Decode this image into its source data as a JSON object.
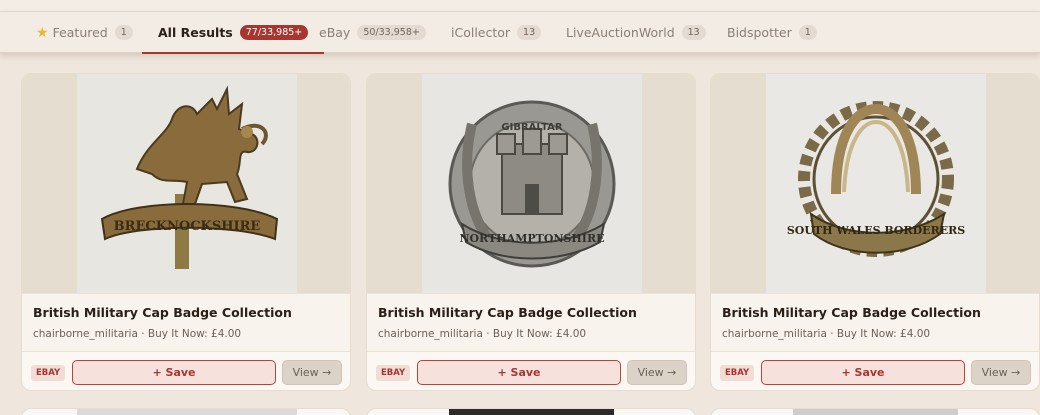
{
  "tabs": [
    {
      "label": "Featured",
      "count": "1",
      "icon": "star-icon"
    },
    {
      "label": "All Results",
      "count": "77/33,985+",
      "active": true
    },
    {
      "label": "eBay",
      "count": "50/33,958+"
    },
    {
      "label": "iCollector",
      "count": "13"
    },
    {
      "label": "LiveAuctionWorld",
      "count": "13"
    },
    {
      "label": "Bidspotter",
      "count": "1"
    }
  ],
  "listings": [
    {
      "title": "British Military Cap Badge Collection",
      "meta": "chairborne_militaria · Buy It Now: £4.00",
      "badge": "EBAY",
      "save_label": "+ Save",
      "view_label": "View →",
      "image": "dragon-badge"
    },
    {
      "title": "British Military Cap Badge Collection",
      "meta": "chairborne_militaria · Buy It Now: £4.00",
      "badge": "EBAY",
      "save_label": "+ Save",
      "view_label": "View →",
      "image": "castle-badge"
    },
    {
      "title": "British Military Cap Badge Collection",
      "meta": "chairborne_militaria · Buy It Now: £4.00",
      "badge": "EBAY",
      "save_label": "+ Save",
      "view_label": "View →",
      "image": "wreath-badge"
    }
  ],
  "colors": {
    "accent": "#a83630",
    "background": "#efe7dd",
    "star": "#e8b83a"
  }
}
